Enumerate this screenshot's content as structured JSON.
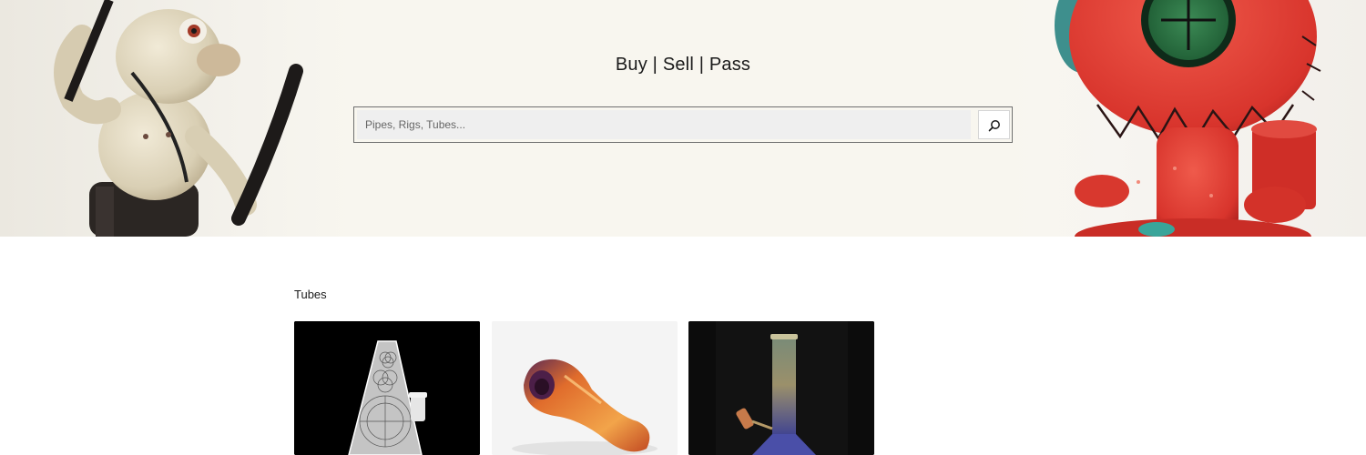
{
  "hero": {
    "title": "Buy | Sell | Pass",
    "left_art": "glass-monkey-figure",
    "right_art": "red-glass-voodoo-rig"
  },
  "search": {
    "placeholder": "Pipes, Rigs, Tubes...",
    "value": "",
    "button_icon": "search-icon"
  },
  "section": {
    "heading": "Tubes"
  },
  "products": [
    {
      "image": "etched-beaker-tube",
      "background": "#000000"
    },
    {
      "image": "fumed-spoon-pipe",
      "background": "#f4f4f4"
    },
    {
      "image": "iridescent-straight-tube",
      "background": "#0c0c0c"
    }
  ],
  "colors": {
    "hero_background": "#f8f6ef",
    "page_background": "#ffffff",
    "search_field": "#efefef",
    "text": "#1b1b1b"
  }
}
